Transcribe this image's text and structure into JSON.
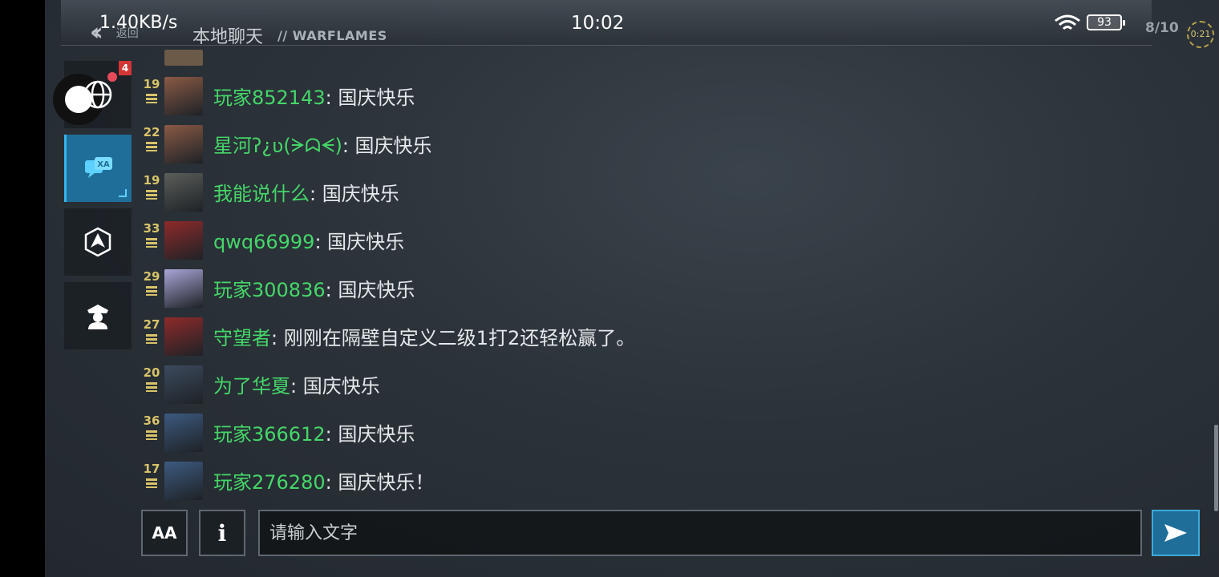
{
  "status_bar": {
    "net_speed": "1.40KB/s",
    "time": "10:02",
    "battery": "93"
  },
  "header": {
    "back_label": "返回",
    "title_cn": "本地聊天",
    "title_en": "// WARFLAMES",
    "room_count": "8/10",
    "timer": "0:21"
  },
  "sidebar": {
    "badge_count": "4",
    "items": [
      {
        "name": "local-chat",
        "icon": "globe-icon"
      },
      {
        "name": "translate-chat",
        "icon": "translate-chat-icon"
      },
      {
        "name": "faction",
        "icon": "emblem-icon"
      },
      {
        "name": "officer",
        "icon": "officer-icon"
      }
    ]
  },
  "colors": {
    "accent": "#1f6e99",
    "name_green": "#45d769",
    "level_gold": "#d8c36a"
  },
  "messages": [
    {
      "level": "19",
      "name": "玩家852143",
      "text": ": 国庆快乐",
      "avatar": "#8a5a45"
    },
    {
      "level": "22",
      "name": "星河ʔ¿ʋ(ᗒᗣᗕ)",
      "text": ": 国庆快乐",
      "avatar": "#8a5a45"
    },
    {
      "level": "19",
      "name": "我能说什么",
      "text": ": 国庆快乐",
      "avatar": "#5b5e5a"
    },
    {
      "level": "33",
      "name": "qwq66999",
      "text": ": 国庆快乐",
      "avatar": "#8f2a2a"
    },
    {
      "level": "29",
      "name": "玩家300836",
      "text": ": 国庆快乐",
      "avatar": "#a9a6d8"
    },
    {
      "level": "27",
      "name": "守望者",
      "text": ": 刚刚在隔壁自定义二级1打2还轻松赢了。",
      "avatar": "#8f2a2a"
    },
    {
      "level": "20",
      "name": "为了华夏",
      "text": ": 国庆快乐",
      "avatar": "#3c4a5e"
    },
    {
      "level": "36",
      "name": "玩家366612",
      "text": ": 国庆快乐",
      "avatar": "#3d5a80"
    },
    {
      "level": "17",
      "name": "玩家276280",
      "text": ": 国庆快乐！",
      "avatar": "#3d5a80"
    }
  ],
  "composer": {
    "font_button": "AA",
    "info_button": "i",
    "placeholder": "请输入文字"
  }
}
